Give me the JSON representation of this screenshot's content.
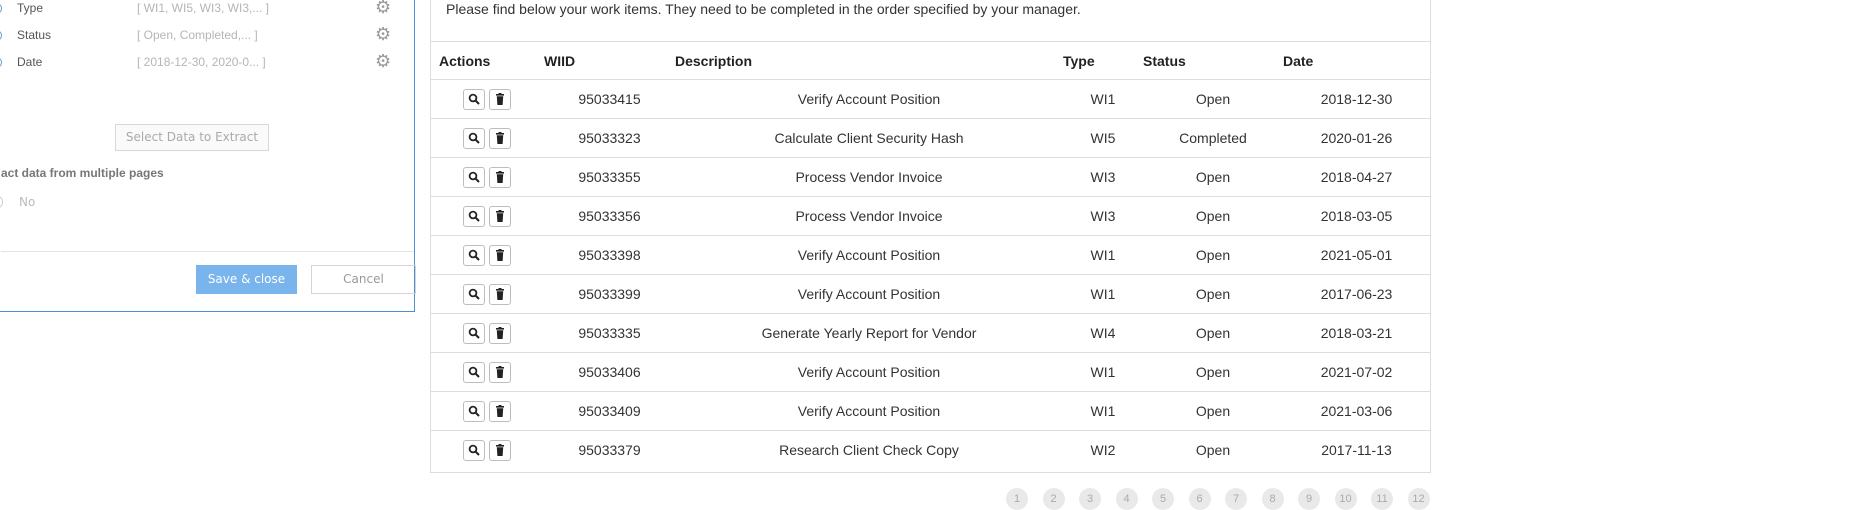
{
  "dialog": {
    "fields": [
      {
        "name": "Type",
        "value": "[ WI1, WI5, WI3, WI3,... ]"
      },
      {
        "name": "Status",
        "value": "[ Open, Completed,... ]"
      },
      {
        "name": "Date",
        "value": "[ 2018-12-30, 2020-0... ]"
      }
    ],
    "select_button": "Select Data to Extract",
    "multi_pages_label": "act data from multiple pages",
    "no_option": "No",
    "save_button": "Save & close",
    "cancel_button": "Cancel"
  },
  "work_items": {
    "intro": "Please find below your work items. They need to be completed in the order specified by your manager.",
    "columns": [
      "Actions",
      "WIID",
      "Description",
      "Type",
      "Status",
      "Date"
    ],
    "rows": [
      {
        "wiid": "95033415",
        "description": "Verify Account Position",
        "type": "WI1",
        "status": "Open",
        "date": "2018-12-30"
      },
      {
        "wiid": "95033323",
        "description": "Calculate Client Security Hash",
        "type": "WI5",
        "status": "Completed",
        "date": "2020-01-26"
      },
      {
        "wiid": "95033355",
        "description": "Process Vendor Invoice",
        "type": "WI3",
        "status": "Open",
        "date": "2018-04-27"
      },
      {
        "wiid": "95033356",
        "description": "Process Vendor Invoice",
        "type": "WI3",
        "status": "Open",
        "date": "2018-03-05"
      },
      {
        "wiid": "95033398",
        "description": "Verify Account Position",
        "type": "WI1",
        "status": "Open",
        "date": "2021-05-01"
      },
      {
        "wiid": "95033399",
        "description": "Verify Account Position",
        "type": "WI1",
        "status": "Open",
        "date": "2017-06-23"
      },
      {
        "wiid": "95033335",
        "description": "Generate Yearly Report for Vendor",
        "type": "WI4",
        "status": "Open",
        "date": "2018-03-21"
      },
      {
        "wiid": "95033406",
        "description": "Verify Account Position",
        "type": "WI1",
        "status": "Open",
        "date": "2021-07-02"
      },
      {
        "wiid": "95033409",
        "description": "Verify Account Position",
        "type": "WI1",
        "status": "Open",
        "date": "2021-03-06"
      },
      {
        "wiid": "95033379",
        "description": "Research Client Check Copy",
        "type": "WI2",
        "status": "Open",
        "date": "2017-11-13"
      }
    ]
  },
  "pagination": {
    "pages": [
      "1",
      "2",
      "3",
      "4",
      "5",
      "6",
      "7",
      "8",
      "9",
      "10",
      "11",
      "12"
    ]
  },
  "icons": {
    "view": "magnifier-icon",
    "delete": "trash-icon",
    "settings": "gear-icon"
  }
}
